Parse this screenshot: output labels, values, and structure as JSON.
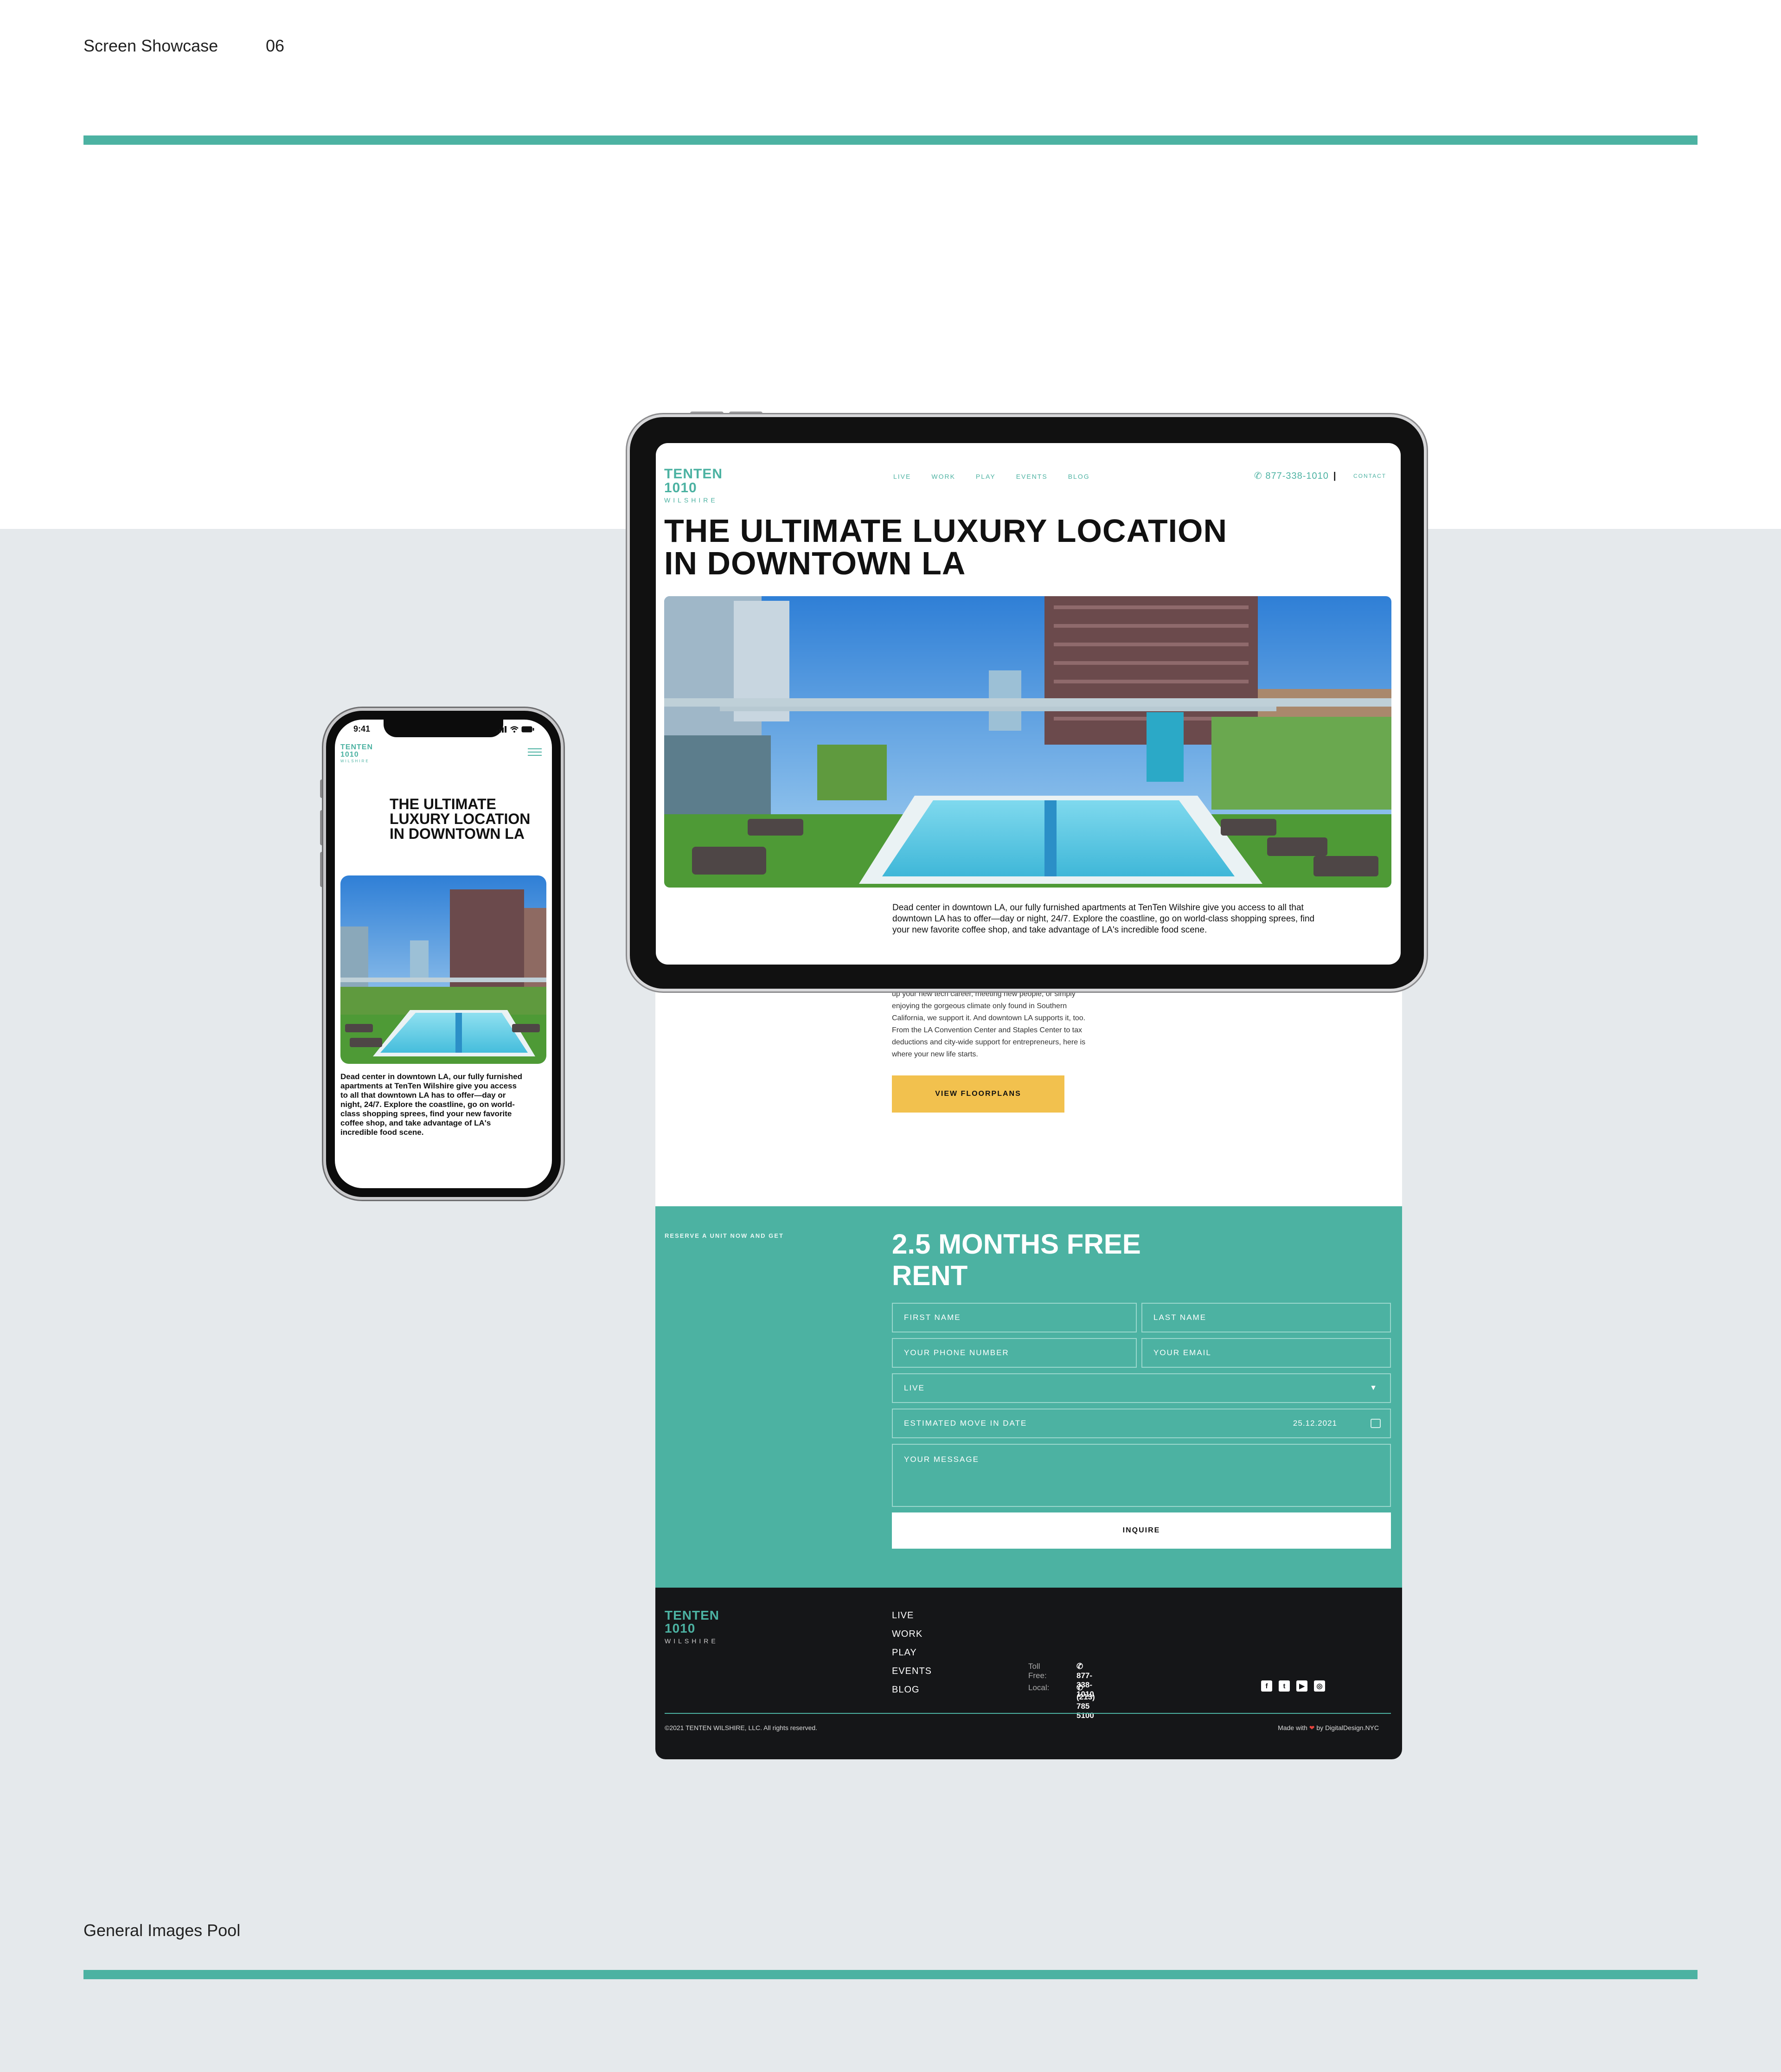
{
  "slide": {
    "header_label": "Screen Showcase",
    "header_number": "06",
    "footer_label": "General Images Pool",
    "accent_color": "#4cb2a2",
    "band_color": "#e5e9ec"
  },
  "brand": {
    "logo_top": "TENTEN",
    "logo_mid": "1010",
    "logo_sub": "WILSHIRE",
    "color": "#4cb2a2"
  },
  "tablet": {
    "nav": [
      "LIVE",
      "WORK",
      "PLAY",
      "EVENTS",
      "BLOG"
    ],
    "phone": "877-338-1010",
    "contact": "CONTACT",
    "hero_title": "THE ULTIMATE LUXURY LOCATION IN DOWNTOWN LA",
    "intro_text": "Dead center in downtown LA, our fully furnished apartments at TenTen Wilshire give you access to all that downtown LA has to offer—day or night, 24/7. Explore the coastline, go on world-class shopping sprees, find your new favorite coffee shop, and take advantage of LA's incredible food scene."
  },
  "long_page": {
    "continued_text": "up your new tech career, meeting new people, or simply\nenjoying the gorgeous climate only found in Southern\nCalifornia, we support it. And downtown LA supports it, too.\nFrom the LA Convention Center and Staples Center to tax\ndeductions and city-wide support for entrepreneurs, here is\nwhere your new life starts.",
    "floorplans_button": "VIEW FLOORPLANS",
    "floorplans_color": "#f2c14e",
    "form": {
      "reserve_label": "RESERVE A UNIT NOW AND GET",
      "offer_title": "2.5 MONTHS FREE RENT",
      "first_name": "FIRST NAME",
      "last_name": "LAST NAME",
      "phone": "YOUR PHONE NUMBER",
      "email": "YOUR EMAIL",
      "select_value": "LIVE",
      "move_in_label": "ESTIMATED MOVE IN DATE",
      "move_in_value": "25.12.2021",
      "message": "YOUR MESSAGE",
      "submit": "INQUIRE"
    },
    "footer": {
      "nav": [
        "LIVE",
        "WORK",
        "PLAY",
        "EVENTS",
        "BLOG"
      ],
      "toll_free_label": "Toll Free:",
      "toll_free": "877-338-1010",
      "local_label": "Local:",
      "local": "(213) 785 5100",
      "social_icons": [
        "facebook-icon",
        "twitter-icon",
        "youtube-icon",
        "instagram-icon"
      ],
      "copyright": "©2021 TENTEN WILSHIRE, LLC. All rights reserved.",
      "made_with_prefix": "Made with",
      "made_with_suffix": "by DigitalDesign.NYC"
    }
  },
  "phone": {
    "time": "9:41",
    "hero_title": "THE ULTIMATE LUXURY LOCATION IN DOWNTOWN LA",
    "intro_text": "Dead center in downtown LA, our fully furnished apartments at TenTen Wilshire give you access to all that downtown LA has to offer—day or night, 24/7. Explore the coastline, go on world-class shopping sprees, find your new favorite coffee shop, and take advantage of LA's incredible food scene."
  }
}
